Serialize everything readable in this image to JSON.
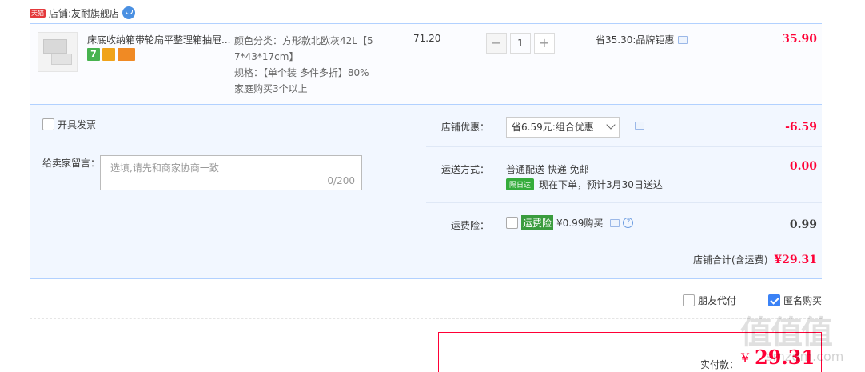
{
  "store": {
    "badge": "天猫",
    "label": "店铺:",
    "name": "友耐旗舰店"
  },
  "item": {
    "title": "床底收纳箱带轮扁平整理箱抽屉...",
    "badge_seven": "7",
    "sku_lines": [
      "颜色分类：方形款北欧灰42L【5",
      "7*43*17cm】",
      "规格：【单个装 多件多折】80%",
      "家庭购买3个以上"
    ],
    "unit_price": "71.20",
    "qty_minus": "−",
    "qty_value": "1",
    "qty_plus": "+",
    "discount_text": "省35.30:品牌钜惠",
    "total": "35.90"
  },
  "options": {
    "invoice_label": "开具发票",
    "message_label": "给卖家留言：",
    "message_placeholder": "选填,请先和商家协商一致",
    "message_count": "0/200",
    "store_discount_label": "店铺优惠：",
    "store_discount_select": "省6.59元:组合优惠",
    "store_discount_value": "-6.59",
    "shipping_label": "运送方式：",
    "shipping_method": "普通配送 快递 免邮",
    "shipping_nextday": "隔日达",
    "shipping_eta": "现在下单，预计3月30日送达",
    "shipping_value": "0.00",
    "insurance_label": "运费险：",
    "insurance_tag": "运费险",
    "insurance_price": "¥0.99购买",
    "insurance_help": "?",
    "insurance_value": "0.99",
    "store_total_label": "店铺合计(含运费)",
    "store_total_value": "¥29.31"
  },
  "pay_options": {
    "friend_pay": "朋友代付",
    "anonymous": "匿名购买"
  },
  "payment": {
    "label": "实付款：",
    "currency": "¥",
    "value": "29.31"
  },
  "watermark": {
    "logo": "值值值",
    "site": "smzdm.com"
  },
  "colors": {
    "accent_red": "#ff0036",
    "border_blue": "#b2d1ff",
    "panel_bg": "#f2f7ff"
  }
}
